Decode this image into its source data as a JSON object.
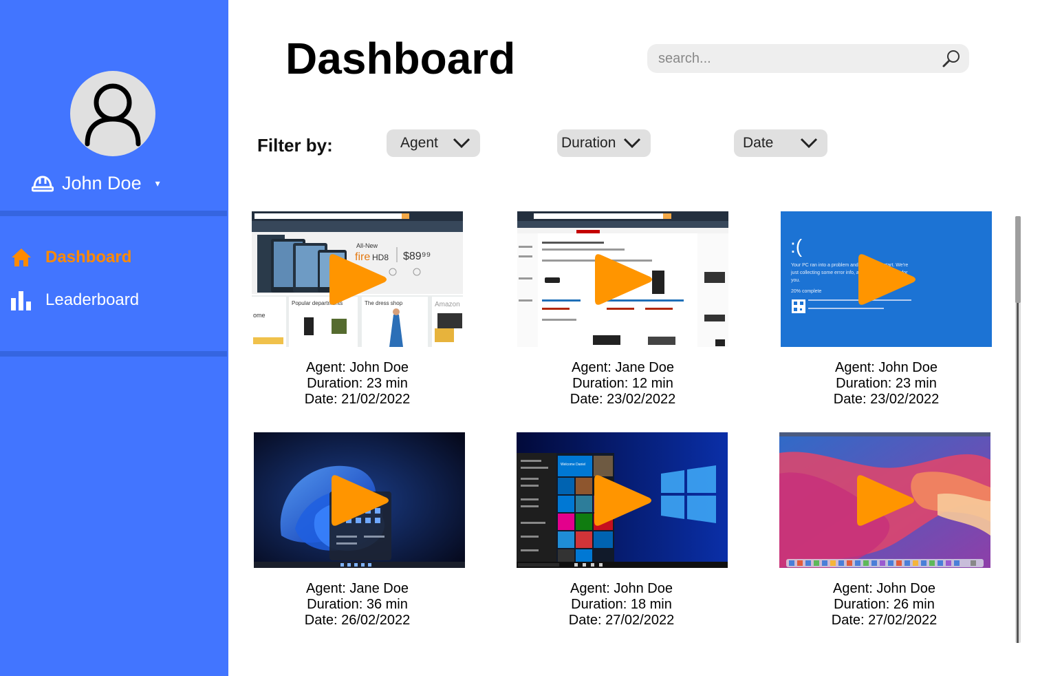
{
  "user": {
    "name": "John Doe",
    "caret": "▾"
  },
  "nav": [
    {
      "label": "Dashboard",
      "icon": "home-icon",
      "active": true
    },
    {
      "label": "Leaderboard",
      "icon": "bar-chart-icon",
      "active": false
    }
  ],
  "page": {
    "title": "Dashboard"
  },
  "search": {
    "placeholder": "search..."
  },
  "filters": {
    "label": "Filter by:",
    "options": [
      "Agent",
      "Duration",
      "Date"
    ]
  },
  "recordings": [
    {
      "agent": "Agent: John Doe",
      "duration": "Duration: 23 min",
      "date": "Date: 21/02/2022",
      "thumbnail": "amazon-fire-hd8-page"
    },
    {
      "agent": "Agent: Jane Doe",
      "duration": "Duration: 12 min",
      "date": "Date: 23/02/2022",
      "thumbnail": "amazon-streaming-players-page"
    },
    {
      "agent": "Agent: John Doe",
      "duration": "Duration: 23 min",
      "date": "Date: 23/02/2022",
      "thumbnail": "windows-blue-screen"
    },
    {
      "agent": "Agent: Jane Doe",
      "duration": "Duration: 36 min",
      "date": "Date: 26/02/2022",
      "thumbnail": "windows-11-desktop"
    },
    {
      "agent": "Agent: John Doe",
      "duration": "Duration: 18 min",
      "date": "Date: 27/02/2022",
      "thumbnail": "windows-10-start-menu"
    },
    {
      "agent": "Agent: John Doe",
      "duration": "Duration: 26 min",
      "date": "Date: 27/02/2022",
      "thumbnail": "macos-big-sur-desktop"
    }
  ],
  "thumb_text": {
    "amazon": {
      "new": "All-New",
      "brand": "fire",
      "model": "HD8",
      "price": "$89⁹⁹",
      "popular": "Popular departments",
      "dress": "The dress shop",
      "amazon": "Amazon",
      "home": "ome"
    },
    "bsod": {
      "face": ":(",
      "line1": "Your PC ran into a problem and needs to restart. We're",
      "line2": "just collecting some error info, and then we'll restart for",
      "line3": "you.",
      "line4": "20% complete"
    },
    "win10": {
      "welcome": "Welcome Daniel"
    }
  },
  "colors": {
    "sidebar": "#4275FF",
    "accent": "#FF8A00",
    "play": "#FF9500",
    "dropdown": "#E0E0E0",
    "search": "#EEEEEE"
  }
}
